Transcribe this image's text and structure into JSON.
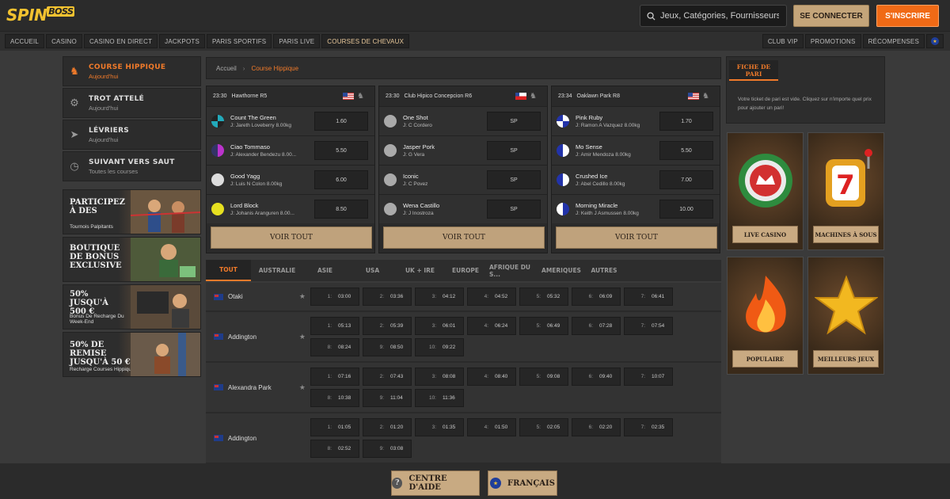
{
  "header": {
    "logo_text": "SPIN",
    "logo_boss": "BOSS",
    "search_placeholder": "Jeux, Catégories, Fournisseurs",
    "login_label": "SE CONNECTER",
    "register_label": "S'INSCRIRE"
  },
  "nav": {
    "items": [
      "ACCUEIL",
      "CASINO",
      "CASINO EN DIRECT",
      "JACKPOTS",
      "PARIS SPORTIFS",
      "PARIS LIVE",
      "COURSES DE CHEVAUX"
    ],
    "active_index": 6,
    "right_items": [
      "CLUB VIP",
      "PROMOTIONS",
      "RÉCOMPENSES"
    ]
  },
  "sidebar": {
    "items": [
      {
        "title": "COURSE HIPPIQUE",
        "sub": "Aujourd'hui",
        "icon": "horse-icon"
      },
      {
        "title": "TROT ATTELÉ",
        "sub": "Aujourd'hui",
        "icon": "harness-icon"
      },
      {
        "title": "LÉVRIERS",
        "sub": "Aujourd'hui",
        "icon": "greyhound-icon"
      },
      {
        "title": "SUIVANT VERS SAUT",
        "sub": "Toutes les courses",
        "icon": "clock-icon"
      }
    ],
    "promos": [
      {
        "title": "PARTICIPEZ À DES",
        "sub": "Tournois Palpitants"
      },
      {
        "title": "BOUTIQUE DE BONUS EXCLUSIVE",
        "sub": ""
      },
      {
        "title": "50% JUSQU'À 500 €",
        "sub": "Bonus De Recharge Du Week-End"
      },
      {
        "title": "50% DE REMISE JUSQU'À 50 €",
        "sub": "Recharge Courses Hippiques"
      }
    ]
  },
  "breadcrumb": {
    "home": "Accueil",
    "current": "Course Hippique"
  },
  "races": [
    {
      "time": "23:30",
      "name": "Hawthorne R5",
      "voir": "VOIR TOUT",
      "runners": [
        {
          "name": "Count The Green",
          "jockey": "J: Jareth Loveberry 8.00kg",
          "odd": "1.60"
        },
        {
          "name": "Ciao Tommaso",
          "jockey": "J: Alexander Bendezu 8.00...",
          "odd": "5.50"
        },
        {
          "name": "Good Yagg",
          "jockey": "J: Luis N Colon 8.00kg",
          "odd": "6.00"
        },
        {
          "name": "Lord Block",
          "jockey": "J: Johanis Aranguren 8.00...",
          "odd": "8.50"
        }
      ]
    },
    {
      "time": "23:30",
      "name": "Club Hipico Concepcion R6",
      "voir": "VOIR TOUT",
      "runners": [
        {
          "name": "One Shot",
          "jockey": "J: C Cordero",
          "odd": "SP"
        },
        {
          "name": "Jasper Pork",
          "jockey": "J: G Vera",
          "odd": "SP"
        },
        {
          "name": "Iconic",
          "jockey": "J: C Povez",
          "odd": "SP"
        },
        {
          "name": "Wena Castillo",
          "jockey": "J: J Inostroza",
          "odd": "SP"
        }
      ]
    },
    {
      "time": "23:34",
      "name": "Oaklawn Park R8",
      "voir": "VOIR TOUT",
      "runners": [
        {
          "name": "Pink Ruby",
          "jockey": "J: Ramon A Vazquez 8.00kg",
          "odd": "1.70"
        },
        {
          "name": "Mo Sense",
          "jockey": "J: Amir Mendoza 8.00kg",
          "odd": "5.50"
        },
        {
          "name": "Crushed Ice",
          "jockey": "J: Abel Cedillo 8.00kg",
          "odd": "7.00"
        },
        {
          "name": "Morning Miracle",
          "jockey": "J: Keith J Asmussen 8.00kg",
          "odd": "10.00"
        }
      ]
    }
  ],
  "region_tabs": [
    "TOUT",
    "AUSTRALIE",
    "ASIE",
    "USA",
    "UK + IRE",
    "EUROPE",
    "AFRIQUE DU S...",
    "AMERIQUES",
    "AUTRES"
  ],
  "tracks": [
    {
      "name": "Otaki",
      "slots": [
        [
          "1:",
          "03:00"
        ],
        [
          "2:",
          "03:36"
        ],
        [
          "3:",
          "04:12"
        ],
        [
          "4:",
          "04:52"
        ],
        [
          "5:",
          "05:32"
        ],
        [
          "6:",
          "06:09"
        ],
        [
          "7:",
          "06:41"
        ]
      ]
    },
    {
      "name": "Addington",
      "slots": [
        [
          "1:",
          "05:13"
        ],
        [
          "2:",
          "05:39"
        ],
        [
          "3:",
          "06:01"
        ],
        [
          "4:",
          "06:24"
        ],
        [
          "5:",
          "06:49"
        ],
        [
          "6:",
          "07:28"
        ],
        [
          "7:",
          "07:54"
        ],
        [
          "8:",
          "08:24"
        ],
        [
          "9:",
          "08:50"
        ],
        [
          "10:",
          "09:22"
        ]
      ]
    },
    {
      "name": "Alexandra Park",
      "slots": [
        [
          "1:",
          "07:16"
        ],
        [
          "2:",
          "07:43"
        ],
        [
          "3:",
          "08:08"
        ],
        [
          "4:",
          "08:40"
        ],
        [
          "5:",
          "09:08"
        ],
        [
          "6:",
          "09:40"
        ],
        [
          "7:",
          "10:07"
        ],
        [
          "8:",
          "10:38"
        ],
        [
          "9:",
          "11:04"
        ],
        [
          "10:",
          "11:36"
        ]
      ]
    },
    {
      "name": "Addington",
      "slots": [
        [
          "1:",
          "01:05"
        ],
        [
          "2:",
          "01:20"
        ],
        [
          "3:",
          "01:35"
        ],
        [
          "4:",
          "01:50"
        ],
        [
          "5:",
          "02:05"
        ],
        [
          "6:",
          "02:20"
        ],
        [
          "7:",
          "02:35"
        ],
        [
          "8:",
          "02:52"
        ],
        [
          "9:",
          "03:08"
        ]
      ]
    }
  ],
  "betslip": {
    "title": "FICHE DE PARI",
    "message": "Votre ticket de pari est vide. Cliquez sur n'importe quel prix pour ajouter un pari!"
  },
  "games": [
    {
      "label": "LIVE CASINO",
      "icon": "casino-chip-icon"
    },
    {
      "label": "MACHINES À SOUS",
      "icon": "slot-machine-icon"
    },
    {
      "label": "POPULAIRE",
      "icon": "fire-icon"
    },
    {
      "label": "MEILLEURS JEUX",
      "icon": "star-icon"
    }
  ],
  "footer": {
    "help": "CENTRE D'AIDE",
    "language": "FRANÇAIS"
  },
  "colors": {
    "accent": "#f07a2a",
    "gold": "#c4a57a",
    "register": "#f06a16"
  }
}
